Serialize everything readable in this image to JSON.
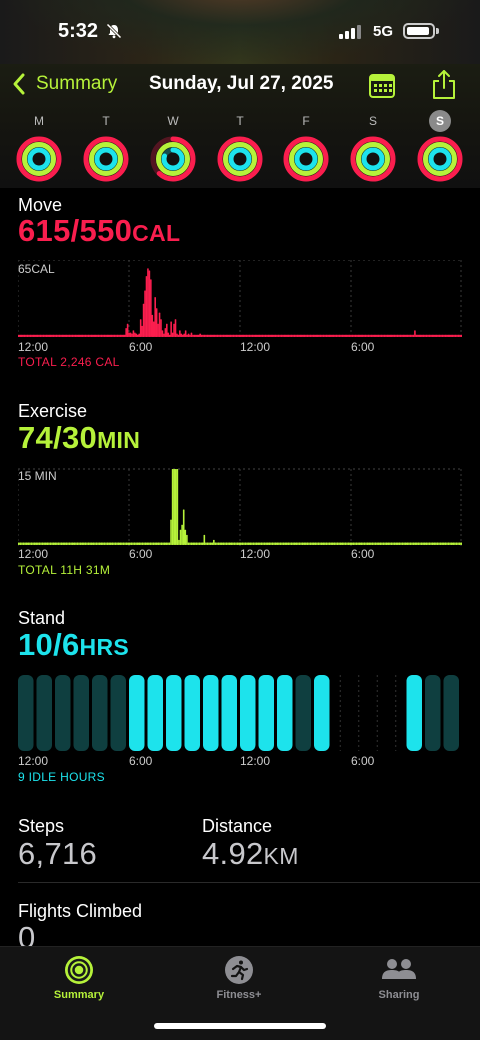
{
  "status_bar": {
    "time": "5:32",
    "network": "5G"
  },
  "header": {
    "back_label": "Summary",
    "date": "Sunday, Jul 27, 2025"
  },
  "week": [
    {
      "letter": "M",
      "move": 1.0,
      "exercise": 1.0,
      "stand": 1.0,
      "selected": false
    },
    {
      "letter": "T",
      "move": 1.0,
      "exercise": 1.0,
      "stand": 1.0,
      "selected": false
    },
    {
      "letter": "W",
      "move": 0.62,
      "exercise": 1.0,
      "stand": 0.8,
      "selected": false
    },
    {
      "letter": "T",
      "move": 1.0,
      "exercise": 1.0,
      "stand": 1.0,
      "selected": false
    },
    {
      "letter": "F",
      "move": 1.0,
      "exercise": 1.0,
      "stand": 1.0,
      "selected": false
    },
    {
      "letter": "S",
      "move": 1.0,
      "exercise": 1.0,
      "stand": 1.0,
      "selected": false
    },
    {
      "letter": "S",
      "move": 1.0,
      "exercise": 1.0,
      "stand": 1.0,
      "selected": true
    }
  ],
  "colors": {
    "move": "#fa1e4e",
    "exercise": "#b6f23a",
    "stand": "#1de3ec",
    "accent": "#b6f23a"
  },
  "move": {
    "label": "Move",
    "value": "615/550",
    "unit": "CAL",
    "scale_label": "65CAL",
    "total": "TOTAL 2,246 CAL"
  },
  "exercise": {
    "label": "Exercise",
    "value": "74/30",
    "unit": "MIN",
    "scale_label": "15 MIN",
    "total": "TOTAL 11H 31M"
  },
  "stand": {
    "label": "Stand",
    "value": "10/6",
    "unit": "HRS",
    "total": "9 IDLE HOURS"
  },
  "time_axis": [
    "12:00",
    "6:00",
    "12:00",
    "6:00"
  ],
  "chart_data": [
    {
      "type": "bar",
      "name": "move",
      "ylim": [
        0,
        65
      ],
      "x": "hours 0-24, 5-minute intervals",
      "values": [
        2,
        2,
        2,
        2,
        2,
        2,
        2,
        2,
        2,
        2,
        2,
        2,
        2,
        2,
        2,
        2,
        2,
        2,
        2,
        2,
        2,
        2,
        2,
        2,
        2,
        2,
        2,
        2,
        2,
        2,
        2,
        2,
        2,
        2,
        2,
        2,
        2,
        2,
        2,
        2,
        2,
        2,
        2,
        2,
        2,
        2,
        2,
        2,
        2,
        2,
        2,
        2,
        2,
        2,
        2,
        2,
        2,
        2,
        2,
        2,
        2,
        2,
        2,
        2,
        2,
        2,
        2,
        2,
        2,
        2,
        2,
        2,
        2,
        2,
        8,
        12,
        4,
        4,
        3,
        6,
        4,
        3,
        2,
        3,
        16,
        10,
        30,
        42,
        55,
        62,
        60,
        52,
        20,
        14,
        36,
        26,
        12,
        22,
        16,
        6,
        3,
        8,
        12,
        4,
        2,
        14,
        4,
        12,
        16,
        3,
        2,
        6,
        3,
        2,
        3,
        6,
        2,
        3,
        2,
        4,
        2,
        2,
        2,
        2,
        2,
        3,
        2,
        2,
        2,
        2,
        2,
        2,
        2,
        2,
        2,
        2,
        2,
        2,
        2,
        2,
        2,
        2,
        2,
        2,
        2,
        2,
        2,
        2,
        2,
        2,
        2,
        2,
        2,
        2,
        2,
        2,
        2,
        2,
        2,
        2,
        2,
        2,
        2,
        2,
        2,
        2,
        2,
        2,
        2,
        2,
        2,
        2,
        2,
        2,
        2,
        2,
        2,
        2,
        2,
        2,
        2,
        2,
        2,
        2,
        2,
        2,
        2,
        2,
        2,
        2,
        2,
        2,
        2,
        2,
        2,
        2,
        2,
        2,
        2,
        2,
        2,
        2,
        2,
        2,
        2,
        2,
        2,
        2,
        2,
        2,
        2,
        2,
        2,
        2,
        2,
        2,
        2,
        2,
        2,
        2,
        2,
        2,
        2,
        2,
        2,
        2,
        2,
        2,
        2,
        2,
        2,
        2,
        2,
        2,
        2,
        2,
        2,
        2,
        2,
        2,
        2,
        2,
        2,
        2,
        2,
        2,
        2,
        2,
        2,
        2,
        2,
        2,
        2,
        2,
        2,
        2,
        2,
        2,
        2,
        2,
        2,
        2,
        2,
        2,
        2,
        2,
        2,
        2,
        2,
        2,
        2,
        2,
        2,
        6,
        2,
        2,
        2,
        2,
        2,
        2,
        2,
        2,
        2,
        2,
        2,
        2,
        2,
        2,
        2,
        2,
        2,
        2,
        2,
        2,
        2,
        2,
        2,
        2,
        2,
        2,
        2,
        2,
        2,
        2,
        2,
        2
      ]
    },
    {
      "type": "bar",
      "name": "exercise",
      "ylim": [
        0,
        15
      ],
      "x": "hours 0-24, 5-minute intervals",
      "values": [
        0.5,
        0.5,
        0.5,
        0.5,
        0.5,
        0.5,
        0.5,
        0.5,
        0.5,
        0.5,
        0.5,
        0.5,
        0.5,
        0.5,
        0.5,
        0.5,
        0.5,
        0.5,
        0.5,
        0.5,
        0.5,
        0.5,
        0.5,
        0.5,
        0.5,
        0.5,
        0.5,
        0.5,
        0.5,
        0.5,
        0.5,
        0.5,
        0.5,
        0.5,
        0.5,
        0.5,
        0.5,
        0.5,
        0.5,
        0.5,
        0.5,
        0.5,
        0.5,
        0.5,
        0.5,
        0.5,
        0.5,
        0.5,
        0.5,
        0.5,
        0.5,
        0.5,
        0.5,
        0.5,
        0.5,
        0.5,
        0.5,
        0.5,
        0.5,
        0.5,
        0.5,
        0.5,
        0.5,
        0.5,
        0.5,
        0.5,
        0.5,
        0.5,
        0.5,
        0.5,
        0.5,
        0.5,
        0.5,
        0.5,
        0.5,
        0.5,
        0.5,
        0.5,
        0.5,
        0.5,
        0.5,
        0.5,
        0.5,
        0.5,
        0.5,
        0.5,
        0.5,
        0.5,
        0.5,
        0.5,
        0.5,
        0.5,
        0.5,
        0.5,
        0.5,
        0.5,
        5,
        15,
        15,
        15,
        15,
        1,
        3,
        4,
        7,
        3,
        2,
        0.5,
        0.5,
        0.5,
        0.5,
        0.5,
        0.5,
        0.5,
        0.5,
        0.5,
        0.5,
        2,
        0.5,
        0.5,
        0.5,
        0.5,
        0.5,
        1,
        0.5,
        0.5,
        0.5,
        0.5,
        0.5,
        0.5,
        0.5,
        0.5,
        0.5,
        0.5,
        0.5,
        0.5,
        0.5,
        0.5,
        0.5,
        0.5,
        0.5,
        0.5,
        0.5,
        0.5,
        0.5,
        0.5,
        0.5,
        0.5,
        0.5,
        0.5,
        0.5,
        0.5,
        0.5,
        0.5,
        0.5,
        0.5,
        0.5,
        0.5,
        0.5,
        0.5,
        0.5,
        0.5,
        0.5,
        0.5,
        0.5,
        0.5,
        0.5,
        0.5,
        0.5,
        0.5,
        0.5,
        0.5,
        0.5,
        0.5,
        0.5,
        0.5,
        0.5,
        0.5,
        0.5,
        0.5,
        0.5,
        0.5,
        0.5,
        0.5,
        0.5,
        0.5,
        0.5,
        0.5,
        0.5,
        0.5,
        0.5,
        0.5,
        0.5,
        0.5,
        0.5,
        0.5,
        0.5,
        0.5,
        0.5,
        0.5,
        0.5,
        0.5,
        0.5,
        0.5,
        0.5,
        0.5,
        0.5,
        0.5,
        0.5,
        0.5,
        0.5,
        0.5,
        0.5,
        0.5,
        0.5,
        0.5,
        0.5,
        0.5,
        0.5,
        0.5,
        0.5,
        0.5,
        0.5,
        0.5,
        0.5,
        0.5,
        0.5,
        0.5,
        0.5,
        0.5,
        0.5,
        0.5,
        0.5,
        0.5,
        0.5,
        0.5,
        0.5,
        0.5,
        0.5,
        0.5,
        0.5,
        0.5,
        0.5,
        0.5,
        0.5,
        0.5,
        0.5,
        0.5,
        0.5,
        0.5,
        0.5,
        0.5,
        0.5,
        0.5,
        0.5,
        0.5,
        0.5,
        0.5,
        0.5,
        0.5,
        0.5,
        0.5,
        0.5,
        0.5,
        0.5,
        0.5,
        0.5,
        0.5,
        0.5,
        0.5,
        0.5,
        0.5,
        0.5,
        0.5,
        0.5,
        0.5,
        0.5,
        0.5,
        0.5,
        0.5
      ]
    },
    {
      "type": "bar",
      "name": "stand",
      "x": "hours 0-24, one bar per hour",
      "values": [
        0,
        0,
        0,
        0,
        0,
        0,
        1,
        1,
        1,
        1,
        1,
        1,
        1,
        1,
        1,
        0,
        1,
        0,
        0,
        0,
        0,
        1,
        0,
        0
      ],
      "active": [
        1,
        1,
        1,
        1,
        1,
        1,
        1,
        1,
        1,
        1,
        1,
        1,
        1,
        1,
        1,
        1,
        1,
        0,
        0,
        0,
        0,
        1,
        1,
        1
      ]
    }
  ],
  "steps": {
    "label": "Steps",
    "value": "6,716"
  },
  "distance": {
    "label": "Distance",
    "value": "4.92",
    "unit": "KM"
  },
  "flights": {
    "label": "Flights Climbed",
    "value": "0"
  },
  "tabs": [
    {
      "label": "Summary",
      "active": true
    },
    {
      "label": "Fitness+",
      "active": false
    },
    {
      "label": "Sharing",
      "active": false
    }
  ]
}
